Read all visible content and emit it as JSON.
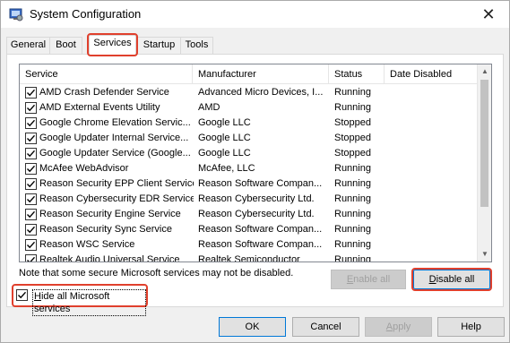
{
  "window": {
    "title": "System Configuration",
    "app_icon": "msconfig-icon",
    "close_glyph": "✕"
  },
  "tabs": [
    {
      "label": "General",
      "active": false
    },
    {
      "label": "Boot",
      "active": false
    },
    {
      "label": "Services",
      "active": true
    },
    {
      "label": "Startup",
      "active": false
    },
    {
      "label": "Tools",
      "active": false
    }
  ],
  "services_table": {
    "columns": [
      "Service",
      "Manufacturer",
      "Status",
      "Date Disabled"
    ],
    "rows": [
      {
        "checked": true,
        "service": "AMD Crash Defender Service",
        "manufacturer": "Advanced Micro Devices, I...",
        "status": "Running",
        "date_disabled": ""
      },
      {
        "checked": true,
        "service": "AMD External Events Utility",
        "manufacturer": "AMD",
        "status": "Running",
        "date_disabled": ""
      },
      {
        "checked": true,
        "service": "Google Chrome Elevation Servic...",
        "manufacturer": "Google LLC",
        "status": "Stopped",
        "date_disabled": ""
      },
      {
        "checked": true,
        "service": "Google Updater Internal Service...",
        "manufacturer": "Google LLC",
        "status": "Stopped",
        "date_disabled": ""
      },
      {
        "checked": true,
        "service": "Google Updater Service (Google...",
        "manufacturer": "Google LLC",
        "status": "Stopped",
        "date_disabled": ""
      },
      {
        "checked": true,
        "service": "McAfee WebAdvisor",
        "manufacturer": "McAfee, LLC",
        "status": "Running",
        "date_disabled": ""
      },
      {
        "checked": true,
        "service": "Reason Security EPP Client Service",
        "manufacturer": "Reason Software Compan...",
        "status": "Running",
        "date_disabled": ""
      },
      {
        "checked": true,
        "service": "Reason Cybersecurity EDR Service",
        "manufacturer": "Reason Cybersecurity Ltd.",
        "status": "Running",
        "date_disabled": ""
      },
      {
        "checked": true,
        "service": "Reason Security Engine Service",
        "manufacturer": "Reason Cybersecurity Ltd.",
        "status": "Running",
        "date_disabled": ""
      },
      {
        "checked": true,
        "service": "Reason Security Sync Service",
        "manufacturer": "Reason Software Compan...",
        "status": "Running",
        "date_disabled": ""
      },
      {
        "checked": true,
        "service": "Reason WSC Service",
        "manufacturer": "Reason Software Compan...",
        "status": "Running",
        "date_disabled": ""
      },
      {
        "checked": true,
        "service": "Realtek Audio Universal Service",
        "manufacturer": "Realtek Semiconductor",
        "status": "Running",
        "date_disabled": ""
      }
    ]
  },
  "note": "Note that some secure Microsoft services may not be disabled.",
  "enable_all": {
    "pre": "",
    "accel": "E",
    "post": "nable all",
    "enabled": false
  },
  "disable_all": {
    "pre": "",
    "accel": "D",
    "post": "isable all",
    "enabled": true
  },
  "hide_ms": {
    "pre": "",
    "accel": "H",
    "post": "ide all Microsoft services",
    "checked": true
  },
  "footer": {
    "ok": "OK",
    "cancel": "Cancel",
    "apply": {
      "pre": "",
      "accel": "A",
      "post": "pply"
    },
    "help": "Help"
  },
  "colors": {
    "highlight": "#e0402d",
    "focus": "#0078d7"
  }
}
